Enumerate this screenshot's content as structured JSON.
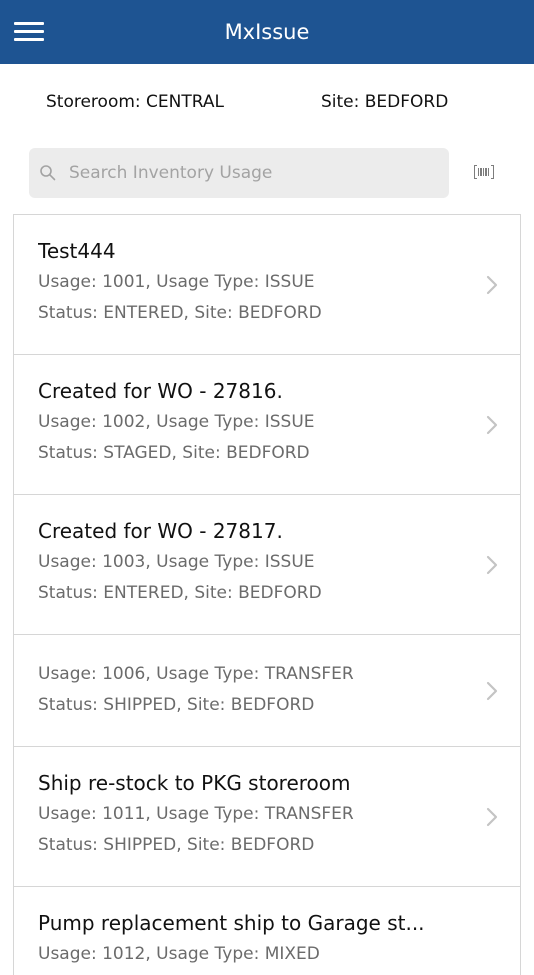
{
  "header": {
    "title": "MxIssue",
    "menu_icon": "hamburger-menu-icon"
  },
  "info": {
    "storeroom": "Storeroom: CENTRAL",
    "site": "Site: BEDFORD"
  },
  "search": {
    "placeholder": "Search Inventory Usage",
    "value": "",
    "icon": "search-icon",
    "scan_icon": "barcode-scan-icon"
  },
  "colors": {
    "navbar": "#1e5492",
    "search_bg": "#ececec",
    "secondary_text": "#6b6b6b"
  },
  "items": [
    {
      "title": "Test444",
      "line1": "Usage: 1001, Usage Type: ISSUE",
      "line2": "Status: ENTERED, Site: BEDFORD"
    },
    {
      "title": "Created for WO - 27816.",
      "line1": "Usage: 1002, Usage Type: ISSUE",
      "line2": "Status: STAGED, Site: BEDFORD"
    },
    {
      "title": "Created for WO - 27817.",
      "line1": "Usage: 1003, Usage Type: ISSUE",
      "line2": "Status: ENTERED, Site: BEDFORD"
    },
    {
      "title": "",
      "line1": "Usage: 1006, Usage Type: TRANSFER",
      "line2": "Status: SHIPPED, Site: BEDFORD"
    },
    {
      "title": "Ship re-stock to PKG storeroom",
      "line1": "Usage: 1011, Usage Type: TRANSFER",
      "line2": "Status: SHIPPED, Site: BEDFORD"
    },
    {
      "title": "Pump replacement ship to Garage st...",
      "line1": "Usage: 1012, Usage Type: MIXED",
      "line2": ""
    }
  ]
}
